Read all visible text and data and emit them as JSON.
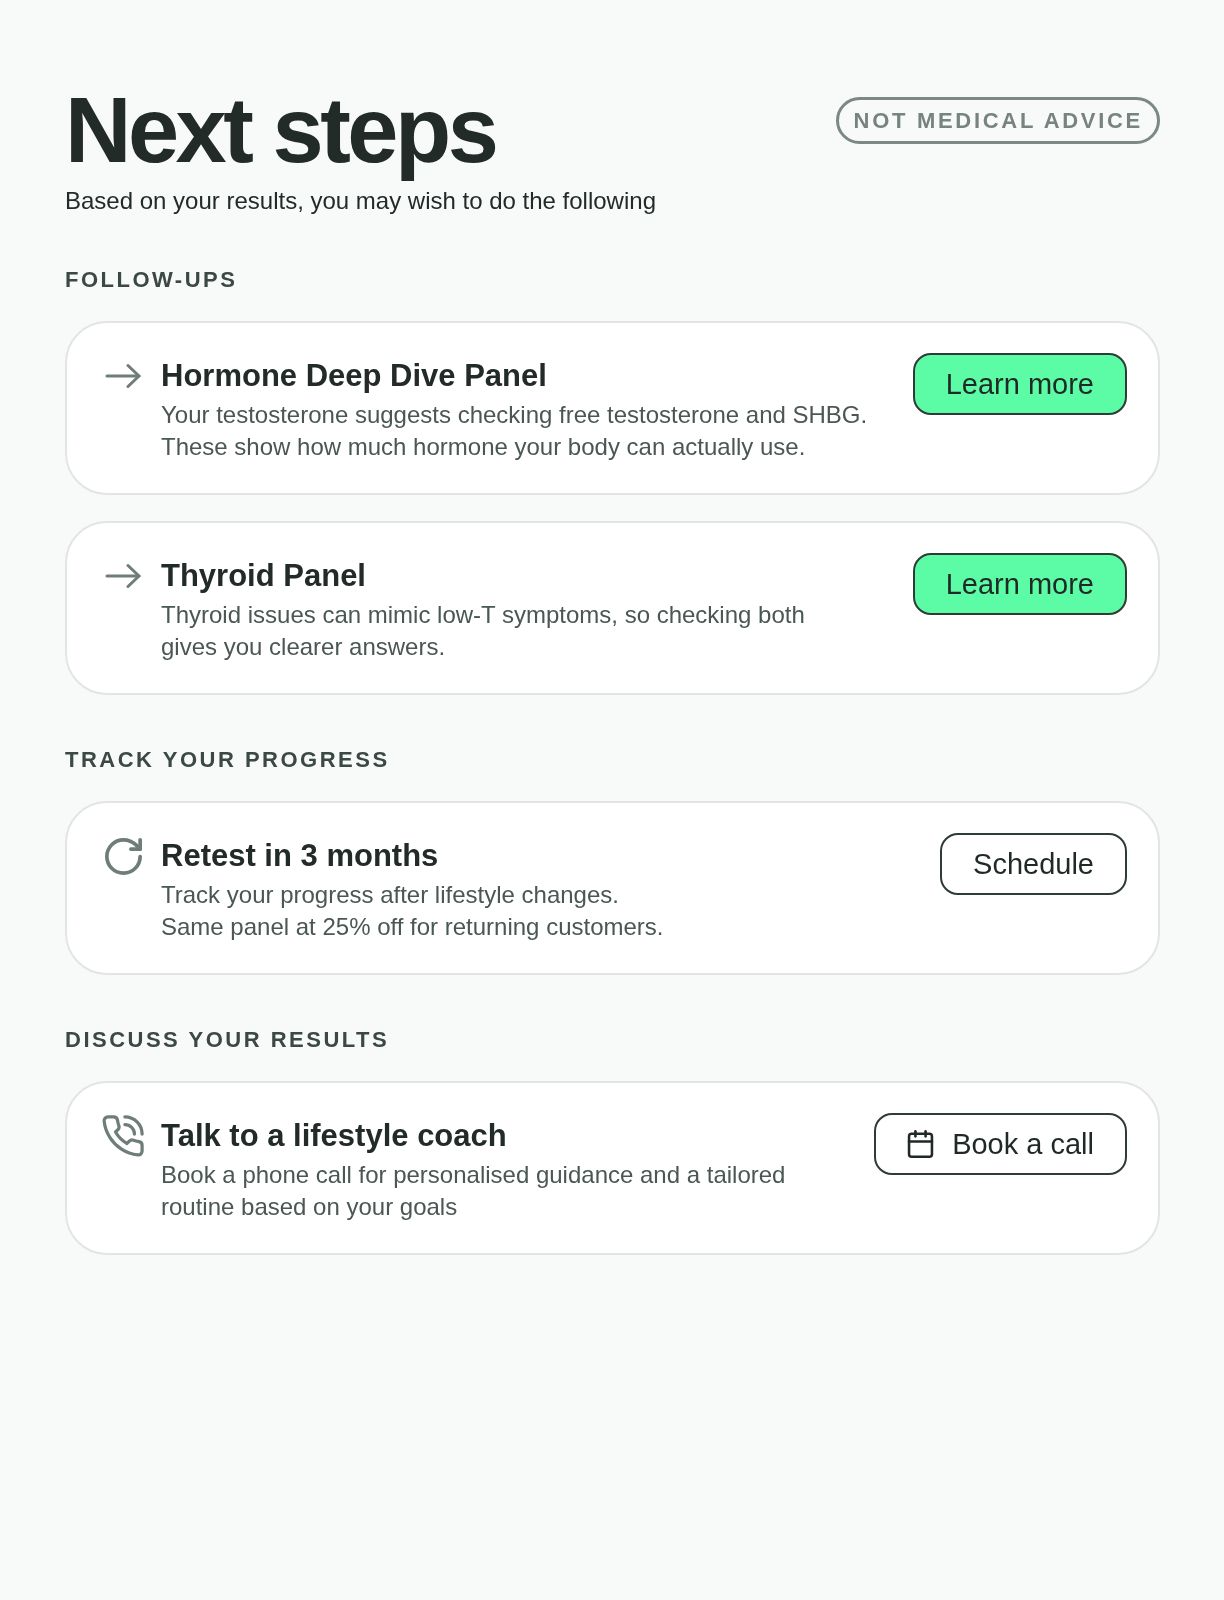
{
  "header": {
    "title": "Next steps",
    "badge": "NOT MEDICAL ADVICE",
    "subtitle": "Based on your results, you may wish to do the following"
  },
  "sections": [
    {
      "heading": "FOLLOW-UPS",
      "cards": [
        {
          "kind": "followup",
          "title": "Hormone Deep Dive Panel",
          "description": "Your testosterone suggests checking free testosterone and SHBG.\nThese show how much hormone your body can actually use.",
          "button": {
            "kind": "primary",
            "label": "Learn more"
          }
        },
        {
          "kind": "followup",
          "title": "Thyroid Panel",
          "description": "Thyroid issues can mimic low-T symptoms, so checking both\ngives you clearer answers.",
          "button": {
            "kind": "primary",
            "label": "Learn more"
          }
        }
      ]
    },
    {
      "heading": "TRACK YOUR PROGRESS",
      "cards": [
        {
          "kind": "retest",
          "title": "Retest in 3 months",
          "description": "Track your progress after lifestyle changes.\nSame panel at 25% off for returning customers.",
          "button": {
            "kind": "outline",
            "label": "Schedule"
          }
        }
      ]
    },
    {
      "heading": "DISCUSS YOUR RESULTS",
      "cards": [
        {
          "kind": "call",
          "title": "Talk to a lifestyle coach",
          "description": "Book a phone call for personalised guidance and a tailored\nroutine based on your goals",
          "button": {
            "kind": "booking",
            "label": "Book a call"
          }
        }
      ]
    }
  ]
}
